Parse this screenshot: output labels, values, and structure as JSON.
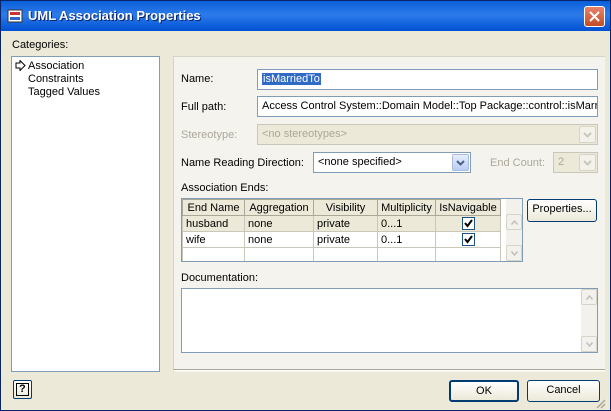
{
  "window": {
    "title": "UML Association Properties"
  },
  "categories": {
    "label": "Categories:",
    "items": [
      {
        "label": "Association",
        "selected": true
      },
      {
        "label": "Constraints"
      },
      {
        "label": "Tagged Values"
      }
    ]
  },
  "form": {
    "name_label": "Name:",
    "name_value": "isMarriedTo",
    "fullpath_label": "Full path:",
    "fullpath_value": "Access Control System::Domain Model::Top Package::control::isMarr",
    "stereotype_label": "Stereotype:",
    "stereotype_value": "<no stereotypes>",
    "reading_label": "Name Reading Direction:",
    "reading_value": "<none specified>",
    "endcount_label": "End Count:",
    "endcount_value": "2"
  },
  "ends": {
    "label": "Association Ends:",
    "columns": [
      "End Name",
      "Aggregation",
      "Visibility",
      "Multiplicity",
      "IsNavigable"
    ],
    "rows": [
      {
        "name": "husband",
        "aggregation": "none",
        "visibility": "private",
        "multiplicity": "0...1",
        "navigable": true
      },
      {
        "name": "wife",
        "aggregation": "none",
        "visibility": "private",
        "multiplicity": "0...1",
        "navigable": true
      }
    ],
    "properties_button": "Properties..."
  },
  "documentation": {
    "label": "Documentation:"
  },
  "footer": {
    "help_icon": "?",
    "ok_button": "OK",
    "cancel_button": "Cancel"
  },
  "colors": {
    "title_bar": "#0a5fd8",
    "selection": "#316ac5",
    "dialog_face": "#ece9d8"
  }
}
